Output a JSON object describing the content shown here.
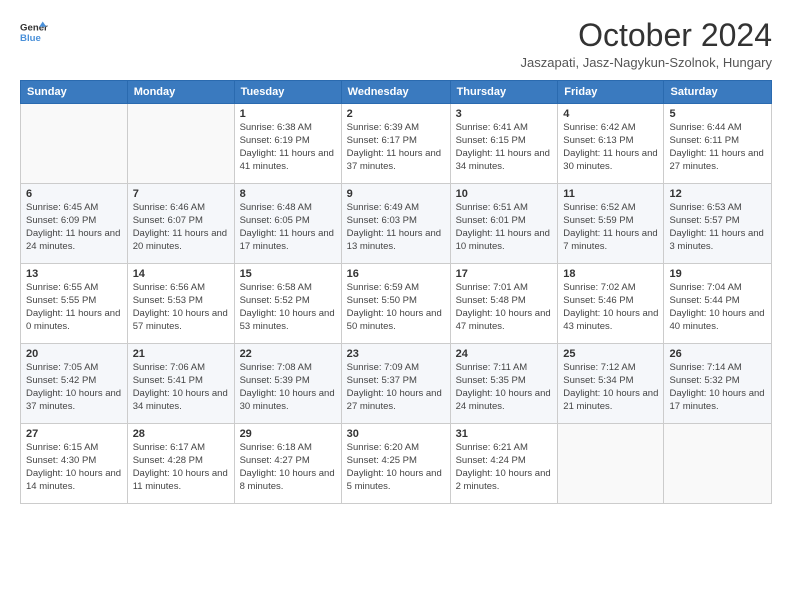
{
  "logo": {
    "line1": "General",
    "line2": "Blue"
  },
  "header": {
    "month": "October 2024",
    "location": "Jaszapati, Jasz-Nagykun-Szolnok, Hungary"
  },
  "weekdays": [
    "Sunday",
    "Monday",
    "Tuesday",
    "Wednesday",
    "Thursday",
    "Friday",
    "Saturday"
  ],
  "weeks": [
    [
      {
        "day": "",
        "info": ""
      },
      {
        "day": "",
        "info": ""
      },
      {
        "day": "1",
        "info": "Sunrise: 6:38 AM\nSunset: 6:19 PM\nDaylight: 11 hours and 41 minutes."
      },
      {
        "day": "2",
        "info": "Sunrise: 6:39 AM\nSunset: 6:17 PM\nDaylight: 11 hours and 37 minutes."
      },
      {
        "day": "3",
        "info": "Sunrise: 6:41 AM\nSunset: 6:15 PM\nDaylight: 11 hours and 34 minutes."
      },
      {
        "day": "4",
        "info": "Sunrise: 6:42 AM\nSunset: 6:13 PM\nDaylight: 11 hours and 30 minutes."
      },
      {
        "day": "5",
        "info": "Sunrise: 6:44 AM\nSunset: 6:11 PM\nDaylight: 11 hours and 27 minutes."
      }
    ],
    [
      {
        "day": "6",
        "info": "Sunrise: 6:45 AM\nSunset: 6:09 PM\nDaylight: 11 hours and 24 minutes."
      },
      {
        "day": "7",
        "info": "Sunrise: 6:46 AM\nSunset: 6:07 PM\nDaylight: 11 hours and 20 minutes."
      },
      {
        "day": "8",
        "info": "Sunrise: 6:48 AM\nSunset: 6:05 PM\nDaylight: 11 hours and 17 minutes."
      },
      {
        "day": "9",
        "info": "Sunrise: 6:49 AM\nSunset: 6:03 PM\nDaylight: 11 hours and 13 minutes."
      },
      {
        "day": "10",
        "info": "Sunrise: 6:51 AM\nSunset: 6:01 PM\nDaylight: 11 hours and 10 minutes."
      },
      {
        "day": "11",
        "info": "Sunrise: 6:52 AM\nSunset: 5:59 PM\nDaylight: 11 hours and 7 minutes."
      },
      {
        "day": "12",
        "info": "Sunrise: 6:53 AM\nSunset: 5:57 PM\nDaylight: 11 hours and 3 minutes."
      }
    ],
    [
      {
        "day": "13",
        "info": "Sunrise: 6:55 AM\nSunset: 5:55 PM\nDaylight: 11 hours and 0 minutes."
      },
      {
        "day": "14",
        "info": "Sunrise: 6:56 AM\nSunset: 5:53 PM\nDaylight: 10 hours and 57 minutes."
      },
      {
        "day": "15",
        "info": "Sunrise: 6:58 AM\nSunset: 5:52 PM\nDaylight: 10 hours and 53 minutes."
      },
      {
        "day": "16",
        "info": "Sunrise: 6:59 AM\nSunset: 5:50 PM\nDaylight: 10 hours and 50 minutes."
      },
      {
        "day": "17",
        "info": "Sunrise: 7:01 AM\nSunset: 5:48 PM\nDaylight: 10 hours and 47 minutes."
      },
      {
        "day": "18",
        "info": "Sunrise: 7:02 AM\nSunset: 5:46 PM\nDaylight: 10 hours and 43 minutes."
      },
      {
        "day": "19",
        "info": "Sunrise: 7:04 AM\nSunset: 5:44 PM\nDaylight: 10 hours and 40 minutes."
      }
    ],
    [
      {
        "day": "20",
        "info": "Sunrise: 7:05 AM\nSunset: 5:42 PM\nDaylight: 10 hours and 37 minutes."
      },
      {
        "day": "21",
        "info": "Sunrise: 7:06 AM\nSunset: 5:41 PM\nDaylight: 10 hours and 34 minutes."
      },
      {
        "day": "22",
        "info": "Sunrise: 7:08 AM\nSunset: 5:39 PM\nDaylight: 10 hours and 30 minutes."
      },
      {
        "day": "23",
        "info": "Sunrise: 7:09 AM\nSunset: 5:37 PM\nDaylight: 10 hours and 27 minutes."
      },
      {
        "day": "24",
        "info": "Sunrise: 7:11 AM\nSunset: 5:35 PM\nDaylight: 10 hours and 24 minutes."
      },
      {
        "day": "25",
        "info": "Sunrise: 7:12 AM\nSunset: 5:34 PM\nDaylight: 10 hours and 21 minutes."
      },
      {
        "day": "26",
        "info": "Sunrise: 7:14 AM\nSunset: 5:32 PM\nDaylight: 10 hours and 17 minutes."
      }
    ],
    [
      {
        "day": "27",
        "info": "Sunrise: 6:15 AM\nSunset: 4:30 PM\nDaylight: 10 hours and 14 minutes."
      },
      {
        "day": "28",
        "info": "Sunrise: 6:17 AM\nSunset: 4:28 PM\nDaylight: 10 hours and 11 minutes."
      },
      {
        "day": "29",
        "info": "Sunrise: 6:18 AM\nSunset: 4:27 PM\nDaylight: 10 hours and 8 minutes."
      },
      {
        "day": "30",
        "info": "Sunrise: 6:20 AM\nSunset: 4:25 PM\nDaylight: 10 hours and 5 minutes."
      },
      {
        "day": "31",
        "info": "Sunrise: 6:21 AM\nSunset: 4:24 PM\nDaylight: 10 hours and 2 minutes."
      },
      {
        "day": "",
        "info": ""
      },
      {
        "day": "",
        "info": ""
      }
    ]
  ]
}
